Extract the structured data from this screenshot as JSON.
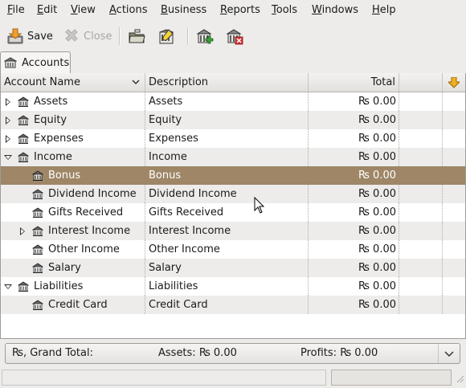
{
  "menu": [
    {
      "label": "File",
      "ul": "F",
      "rest": "ile"
    },
    {
      "label": "Edit",
      "ul": "E",
      "rest": "dit"
    },
    {
      "label": "View",
      "ul": "V",
      "rest": "iew"
    },
    {
      "label": "Actions",
      "ul": "A",
      "rest": "ctions"
    },
    {
      "label": "Business",
      "ul": "B",
      "rest": "usiness"
    },
    {
      "label": "Reports",
      "ul": "R",
      "rest": "eports"
    },
    {
      "label": "Tools",
      "ul": "T",
      "rest": "ools"
    },
    {
      "label": "Windows",
      "ul": "W",
      "rest": "indows"
    },
    {
      "label": "Help",
      "ul": "H",
      "rest": "elp"
    }
  ],
  "toolbar": {
    "save_label": "Save",
    "close_label": "Close",
    "icons": [
      "save-icon",
      "close-icon",
      "open-account-icon",
      "edit-account-icon",
      "new-account-icon",
      "delete-account-icon"
    ]
  },
  "tab": {
    "label": "Accounts",
    "icon": "accounts-tab-icon"
  },
  "columns": {
    "name": "Account Name",
    "description": "Description",
    "total": "Total"
  },
  "rows": [
    {
      "name": "Assets",
      "description": "Assets",
      "total": "₨ 0.00",
      "indent": 0,
      "expander": "closed",
      "selected": false
    },
    {
      "name": "Equity",
      "description": "Equity",
      "total": "₨ 0.00",
      "indent": 0,
      "expander": "closed",
      "selected": false
    },
    {
      "name": "Expenses",
      "description": "Expenses",
      "total": "₨ 0.00",
      "indent": 0,
      "expander": "closed",
      "selected": false
    },
    {
      "name": "Income",
      "description": "Income",
      "total": "₨ 0.00",
      "indent": 0,
      "expander": "open",
      "selected": false
    },
    {
      "name": "Bonus",
      "description": "Bonus",
      "total": "₨ 0.00",
      "indent": 1,
      "expander": "none",
      "selected": true
    },
    {
      "name": "Dividend Income",
      "description": "Dividend Income",
      "total": "₨ 0.00",
      "indent": 1,
      "expander": "none",
      "selected": false
    },
    {
      "name": "Gifts Received",
      "description": "Gifts Received",
      "total": "₨ 0.00",
      "indent": 1,
      "expander": "none",
      "selected": false
    },
    {
      "name": "Interest Income",
      "description": "Interest Income",
      "total": "₨ 0.00",
      "indent": 1,
      "expander": "closed",
      "selected": false
    },
    {
      "name": "Other Income",
      "description": "Other Income",
      "total": "₨ 0.00",
      "indent": 1,
      "expander": "none",
      "selected": false
    },
    {
      "name": "Salary",
      "description": "Salary",
      "total": "₨ 0.00",
      "indent": 1,
      "expander": "none",
      "selected": false
    },
    {
      "name": "Liabilities",
      "description": "Liabilities",
      "total": "₨ 0.00",
      "indent": 0,
      "expander": "open",
      "selected": false
    },
    {
      "name": "Credit Card",
      "description": "Credit Card",
      "total": "₨ 0.00",
      "indent": 1,
      "expander": "none",
      "selected": false
    }
  ],
  "summary": {
    "grand_total": "₨, Grand Total:",
    "assets": "Assets: ₨ 0.00",
    "profits": "Profits: ₨ 0.00"
  },
  "colors": {
    "selection": "#9e8667",
    "accent_arrow": "#e8a317"
  }
}
